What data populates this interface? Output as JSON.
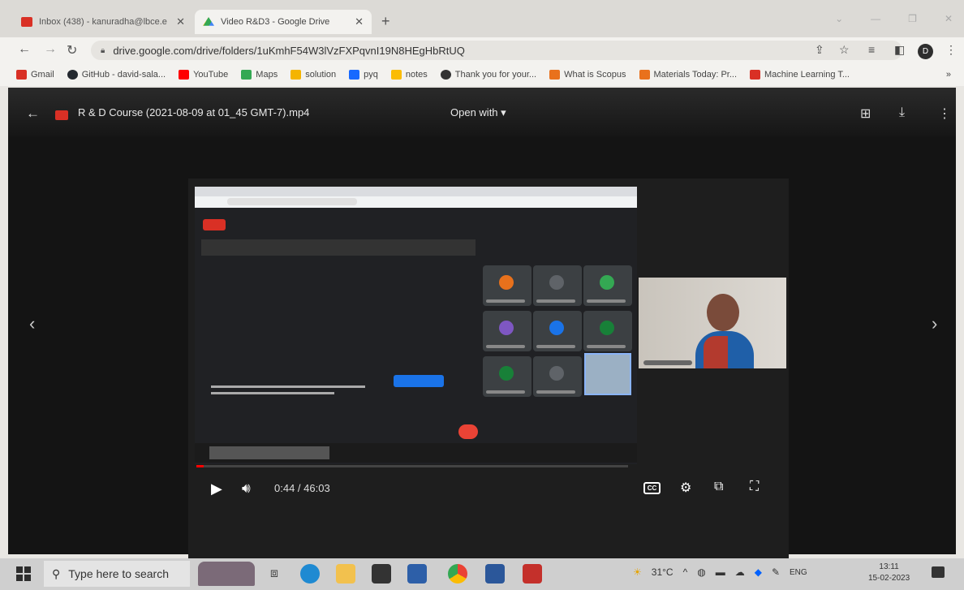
{
  "browser": {
    "tabs": [
      {
        "title": "Inbox (438) - kanuradha@lbce.e",
        "active": false
      },
      {
        "title": "Video R&D3 - Google Drive",
        "active": true
      }
    ],
    "url": "drive.google.com/drive/folders/1uKmhF54W3lVzFXPqvnI19N8HEgHbRtUQ",
    "profile_initial": "D",
    "bookmarks": [
      {
        "label": "Gmail",
        "color": "#d93025"
      },
      {
        "label": "GitHub - david-sala...",
        "color": "#24292f"
      },
      {
        "label": "YouTube",
        "color": "#ff0000"
      },
      {
        "label": "Maps",
        "color": "#34a853"
      },
      {
        "label": "solution",
        "color": "#f4b400"
      },
      {
        "label": "pyq",
        "color": "#1769ff"
      },
      {
        "label": "notes",
        "color": "#fbbc04"
      },
      {
        "label": "Thank you for your...",
        "color": "#333333"
      },
      {
        "label": "What is Scopus",
        "color": "#e9711c"
      },
      {
        "label": "Materials Today: Pr...",
        "color": "#e9711c"
      },
      {
        "label": "Machine Learning T...",
        "color": "#d93025"
      }
    ],
    "bookmark_more": "»"
  },
  "viewer": {
    "filename": "R & D Course (2021-08-09 at 01_45 GMT-7).mp4",
    "open_with": "Open with",
    "time": "0:44 / 46:03",
    "progress_fraction": 0.016,
    "cc_label": "CC"
  },
  "taskbar": {
    "search_placeholder": "Type here to search",
    "weather": "31°C",
    "language": "ENG",
    "time": "13:11",
    "date": "15-02-2023"
  },
  "colors": {
    "accent": "#1a73e8",
    "record": "#d93025",
    "progress": "#ff0000"
  }
}
